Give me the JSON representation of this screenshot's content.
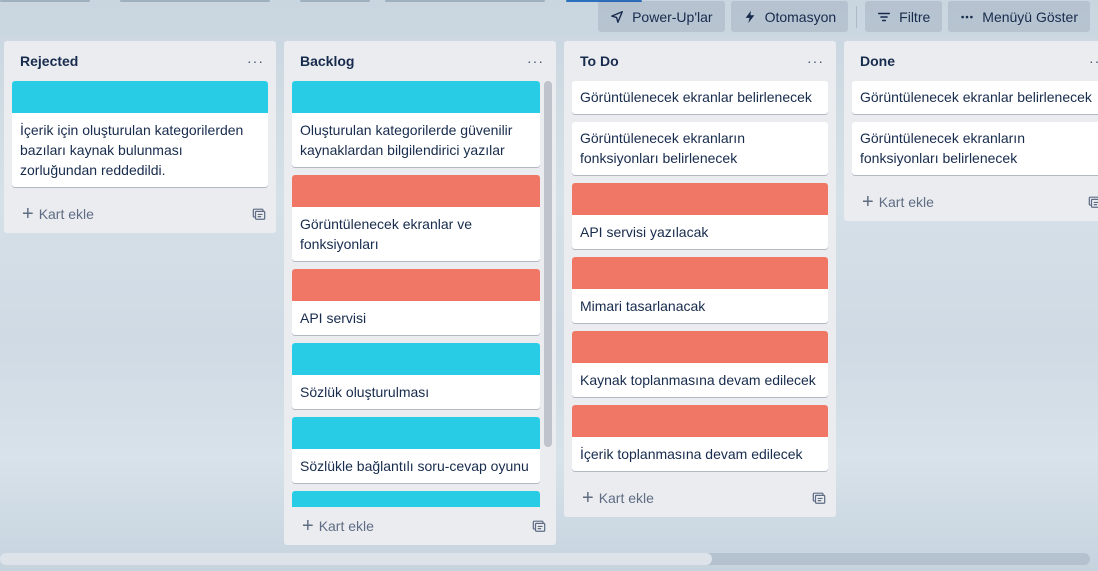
{
  "toolbar": {
    "powerups_label": "Power-Up'lar",
    "automation_label": "Otomasyon",
    "filter_label": "Filtre",
    "menu_label": "Menüyü Göster"
  },
  "colors": {
    "teal": "#29cce5",
    "salmon": "#f07766",
    "list_bg": "#ebecf0"
  },
  "lists": [
    {
      "title": "Rejected",
      "menu": "···",
      "add_label": "Kart ekle",
      "cards": [
        {
          "cover": "teal",
          "text": "İçerik için oluşturulan kategorilerden bazıları kaynak bulunması zorluğundan reddedildi."
        }
      ]
    },
    {
      "title": "Backlog",
      "menu": "···",
      "add_label": "Kart ekle",
      "cards": [
        {
          "cover": "teal",
          "text": "Oluşturulan kategorilerde güvenilir kaynaklardan bilgilendirici yazılar"
        },
        {
          "cover": "salmon",
          "text": "Görüntülenecek ekranlar ve fonksiyonları"
        },
        {
          "cover": "salmon",
          "text": "API servisi"
        },
        {
          "cover": "teal",
          "text": "Sözlük oluşturulması"
        },
        {
          "cover": "teal",
          "text": "Sözlükle bağlantılı soru-cevap oyunu"
        },
        {
          "cover": "teal",
          "text": ""
        }
      ]
    },
    {
      "title": "To Do",
      "menu": "···",
      "add_label": "Kart ekle",
      "cards": [
        {
          "cover": "",
          "text": "Görüntülenecek ekranlar belirlenecek"
        },
        {
          "cover": "",
          "text": "Görüntülenecek ekranların fonksiyonları belirlenecek"
        },
        {
          "cover": "salmon",
          "text": "API servisi yazılacak"
        },
        {
          "cover": "salmon",
          "text": "Mimari tasarlanacak"
        },
        {
          "cover": "salmon",
          "text": "Kaynak toplanmasına devam edilecek"
        },
        {
          "cover": "salmon",
          "text": "İçerik toplanmasına devam edilecek"
        }
      ]
    },
    {
      "title": "Done",
      "menu": "···",
      "add_label": "Kart ekle",
      "cards": [
        {
          "cover": "",
          "text": "Görüntülenecek ekranlar belirlenecek"
        },
        {
          "cover": "",
          "text": "Görüntülenecek ekranların fonksiyonları belirlenecek"
        }
      ]
    }
  ]
}
